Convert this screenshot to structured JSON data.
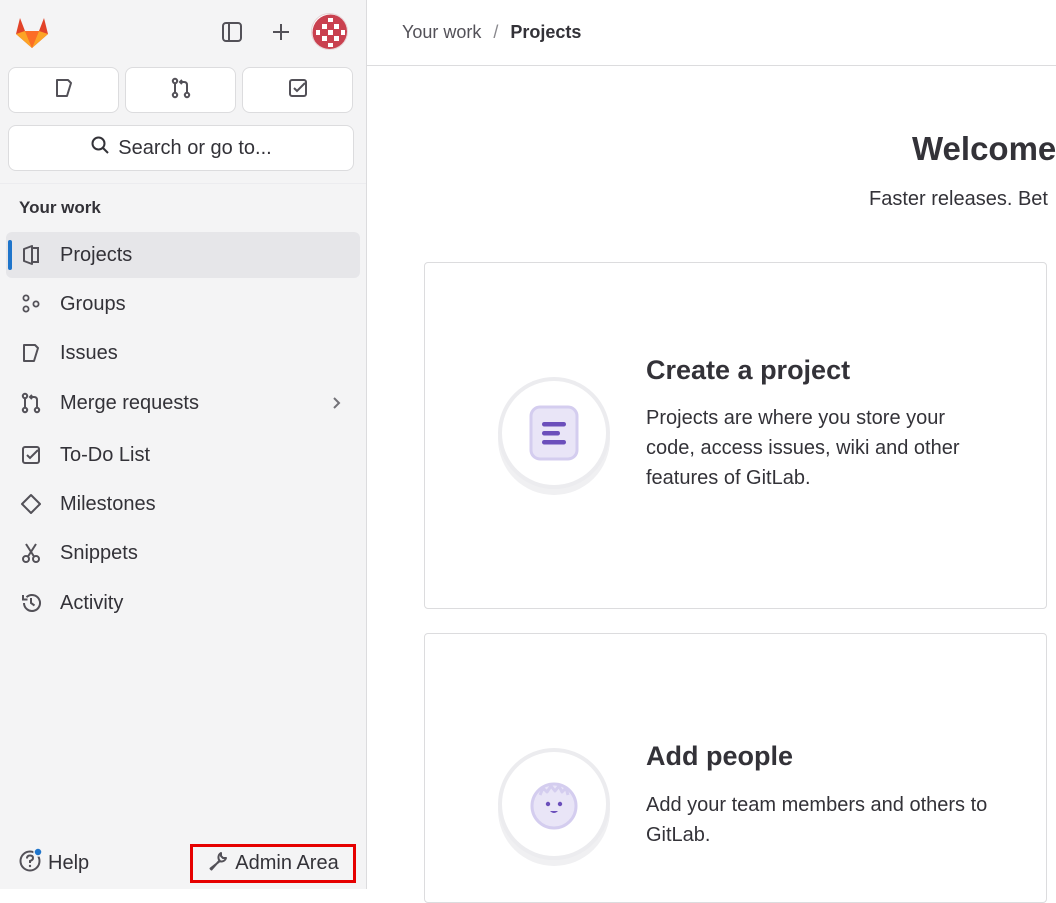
{
  "sidebar": {
    "logo_icon": "gitlab-tanuki-icon",
    "toggle_icon": "sidebar-toggle-icon",
    "new_icon": "plus-icon",
    "avatar_icon": "user-avatar",
    "quick_actions": [
      {
        "icon": "issues-icon"
      },
      {
        "icon": "merge-request-icon"
      },
      {
        "icon": "todo-icon"
      }
    ],
    "search_placeholder": "Search or go to...",
    "section_title": "Your work",
    "items": [
      {
        "label": "Projects",
        "icon": "project-icon",
        "active": true
      },
      {
        "label": "Groups",
        "icon": "group-icon"
      },
      {
        "label": "Issues",
        "icon": "issues-icon"
      },
      {
        "label": "Merge requests",
        "icon": "merge-request-icon",
        "has_submenu": true
      },
      {
        "label": "To-Do List",
        "icon": "todo-icon"
      },
      {
        "label": "Milestones",
        "icon": "milestone-icon"
      },
      {
        "label": "Snippets",
        "icon": "snippet-icon"
      },
      {
        "label": "Activity",
        "icon": "history-icon"
      }
    ],
    "help_label": "Help",
    "admin_label": "Admin Area"
  },
  "breadcrumb": {
    "items": [
      "Your work",
      "Projects"
    ]
  },
  "main": {
    "welcome_title": "Welcome",
    "welcome_subtitle": "Faster releases. Bet",
    "cards": [
      {
        "title": "Create a project",
        "text": "Projects are where you store your code, access issues, wiki and other features of GitLab.",
        "icon": "create-project-illustration"
      },
      {
        "title": "Add people",
        "text": "Add your team members and others to GitLab.",
        "icon": "add-people-illustration"
      }
    ]
  },
  "colors": {
    "accent": "#1f75cb",
    "sidebar_bg": "#f4f4f5",
    "highlight_box": "#e60000",
    "illustration_purple": "#6b4fbb"
  }
}
